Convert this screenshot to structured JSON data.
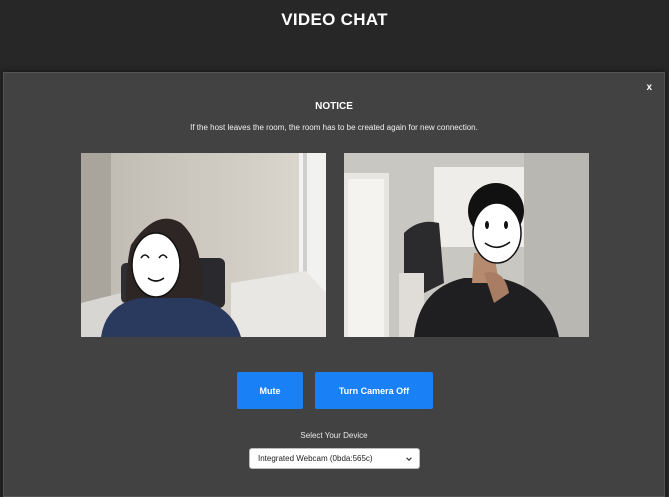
{
  "app": {
    "title": "VIDEO CHAT"
  },
  "modal": {
    "close_label": "x",
    "notice_title": "NOTICE",
    "notice_text": "If the host leaves the room, the room has to be created again for new connection."
  },
  "videos": {
    "local": {
      "name": "local-video"
    },
    "remote": {
      "name": "remote-video"
    }
  },
  "controls": {
    "mute_label": "Mute",
    "camera_label": "Turn Camera Off"
  },
  "device": {
    "label": "Select Your Device",
    "selected": "Integrated Webcam (0bda:565c)"
  },
  "colors": {
    "background": "#272727",
    "modal": "#424242",
    "button": "#1a80f5"
  }
}
